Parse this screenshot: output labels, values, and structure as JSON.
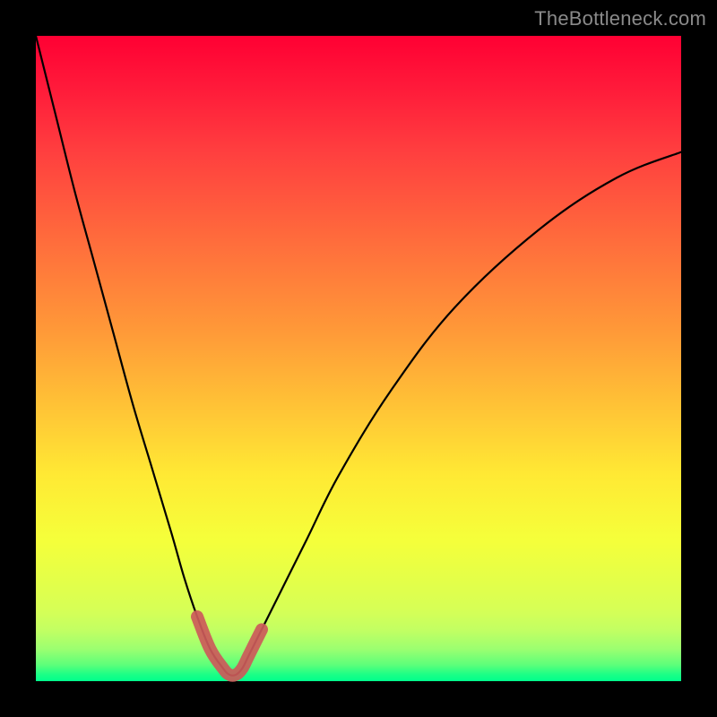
{
  "watermark": "TheBottleneck.com",
  "colors": {
    "curve": "#000000",
    "highlight": "#cc5a5a",
    "background_top": "#ff0033",
    "background_bottom": "#00ff8c"
  },
  "chart_data": {
    "type": "line",
    "title": "",
    "xlabel": "",
    "ylabel": "",
    "xlim": [
      0,
      100
    ],
    "ylim": [
      0,
      100
    ],
    "grid": false,
    "note": "Values estimated from pixel positions; no axis ticks or labels are rendered in the image.",
    "series": [
      {
        "name": "bottleneck-curve",
        "x": [
          0,
          3,
          6,
          9,
          12,
          15,
          18,
          21,
          23,
          25,
          27,
          29,
          30,
          31,
          32,
          33,
          35,
          38,
          42,
          47,
          55,
          65,
          78,
          90,
          100
        ],
        "y": [
          100,
          88,
          76,
          65,
          54,
          43,
          33,
          23,
          16,
          10,
          5,
          2,
          1,
          1,
          2,
          4,
          8,
          14,
          22,
          32,
          45,
          58,
          70,
          78,
          82
        ]
      }
    ],
    "highlight_segment": {
      "name": "near-minimum",
      "description": "thick red overlay near the valley bottom",
      "x": [
        25,
        27,
        29,
        30,
        31,
        32,
        33,
        35
      ],
      "y": [
        10,
        5,
        2,
        1,
        1,
        2,
        4,
        8
      ]
    }
  }
}
